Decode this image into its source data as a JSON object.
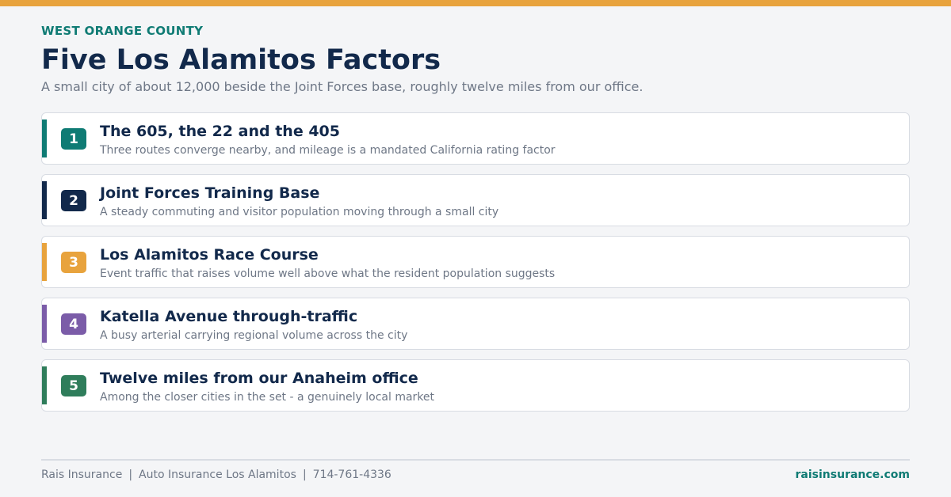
{
  "header": {
    "eyebrow": "WEST ORANGE COUNTY",
    "title": "Five Los Alamitos Factors",
    "subtitle": "A small city of about 12,000 beside the Joint Forces base, roughly twelve miles from our office."
  },
  "colors": {
    "top_bar": "#e8a33d",
    "accent_teal": "#0f7b74",
    "navy": "#12294b"
  },
  "factors": [
    {
      "number": "1",
      "title": "The 605, the 22 and the 405",
      "description": "Three routes converge nearby, and mileage is a mandated California rating factor",
      "color": "#0f7b74"
    },
    {
      "number": "2",
      "title": "Joint Forces Training Base",
      "description": "A steady commuting and visitor population moving through a small city",
      "color": "#12294b"
    },
    {
      "number": "3",
      "title": "Los Alamitos Race Course",
      "description": "Event traffic that raises volume well above what the resident population suggests",
      "color": "#e8a33d"
    },
    {
      "number": "4",
      "title": "Katella Avenue through-traffic",
      "description": "A busy arterial carrying regional volume across the city",
      "color": "#7b5ca8"
    },
    {
      "number": "5",
      "title": "Twelve miles from our Anaheim office",
      "description": "Among the closer cities in the set - a genuinely local market",
      "color": "#2f7d5b"
    }
  ],
  "footer": {
    "company": "Rais Insurance",
    "service": "Auto Insurance Los Alamitos",
    "phone": "714-761-4336",
    "separator": "|",
    "website": "raisinsurance.com"
  }
}
